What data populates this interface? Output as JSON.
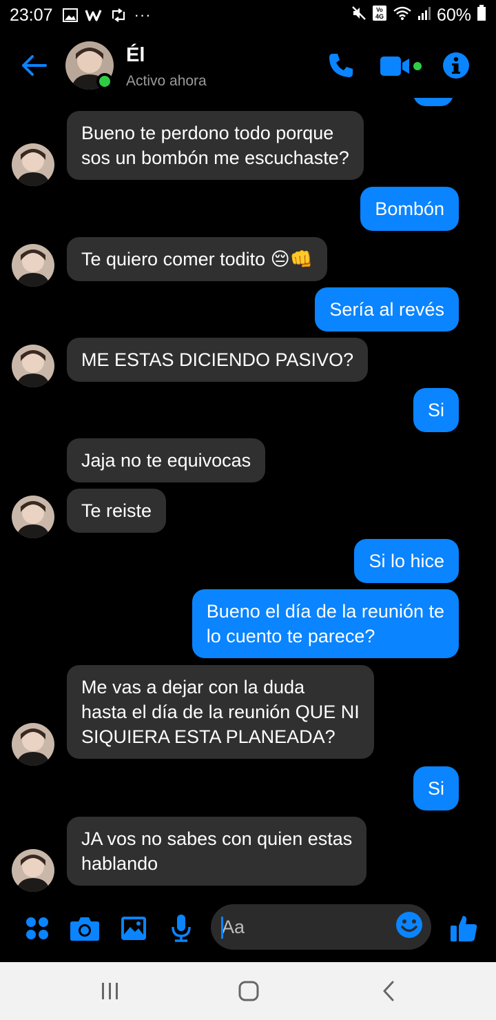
{
  "status_bar": {
    "time": "23:07",
    "more": "···",
    "network_label": "VoLTE 4G",
    "battery": "60%"
  },
  "header": {
    "contact_name": "Él",
    "contact_status": "Activo ahora",
    "accent_color": "#0a84ff",
    "online_color": "#31cc46"
  },
  "messages": [
    {
      "from": "them",
      "text": [
        "Bueno te perdono todo porque",
        "sos un bombón me escuchaste?"
      ]
    },
    {
      "from": "me",
      "text": [
        "Bombón"
      ]
    },
    {
      "from": "them",
      "text": [
        "Te quiero comer todito 😔👊"
      ]
    },
    {
      "from": "me",
      "text": [
        "Sería al revés"
      ]
    },
    {
      "from": "them",
      "text": [
        "ME ESTAS DICIENDO PASIVO?"
      ]
    },
    {
      "from": "me",
      "text": [
        "Si"
      ]
    },
    {
      "from": "them",
      "text": [
        "Jaja no te equivocas"
      ]
    },
    {
      "from": "them",
      "text": [
        "Te reiste"
      ]
    },
    {
      "from": "me",
      "text": [
        "Si lo hice"
      ]
    },
    {
      "from": "me",
      "text": [
        "Bueno el día de la reunión te",
        "lo cuento te parece?"
      ]
    },
    {
      "from": "them",
      "text": [
        "Me vas a dejar con la duda",
        "hasta el día de la reunión QUE NI",
        "SIQUIERA ESTA PLANEADA?"
      ]
    },
    {
      "from": "me",
      "text": [
        "Si"
      ]
    },
    {
      "from": "them",
      "text": [
        "JA vos no sabes con quien estas",
        "hablando"
      ]
    }
  ],
  "composer": {
    "placeholder": "Aa",
    "icons": [
      "apps-icon",
      "camera-icon",
      "gallery-icon",
      "microphone-icon",
      "emoji-icon",
      "thumbs-up-icon"
    ]
  }
}
